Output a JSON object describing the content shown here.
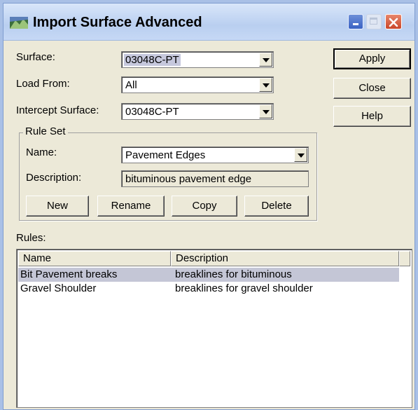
{
  "window": {
    "title": "Import Surface Advanced"
  },
  "form": {
    "surface_label": "Surface:",
    "surface_value": "03048C-PT",
    "load_from_label": "Load From:",
    "load_from_value": "All",
    "intercept_label": "Intercept Surface:",
    "intercept_value": "03048C-PT"
  },
  "side_buttons": {
    "apply": "Apply",
    "close": "Close",
    "help": "Help"
  },
  "rule_set": {
    "title": "Rule Set",
    "name_label": "Name:",
    "name_value": "Pavement Edges",
    "description_label": "Description:",
    "description_value": "bituminous pavement edge",
    "new_button": "New",
    "rename_button": "Rename",
    "copy_button": "Copy",
    "delete_button": "Delete"
  },
  "rules": {
    "label": "Rules:",
    "columns": [
      "Name",
      "Description"
    ],
    "rows": [
      {
        "name": "Bit Pavement breaks",
        "description": "breaklines for bituminous",
        "selected": true
      },
      {
        "name": "Gravel Shoulder",
        "description": "breaklines for gravel shoulder",
        "selected": false
      }
    ]
  }
}
